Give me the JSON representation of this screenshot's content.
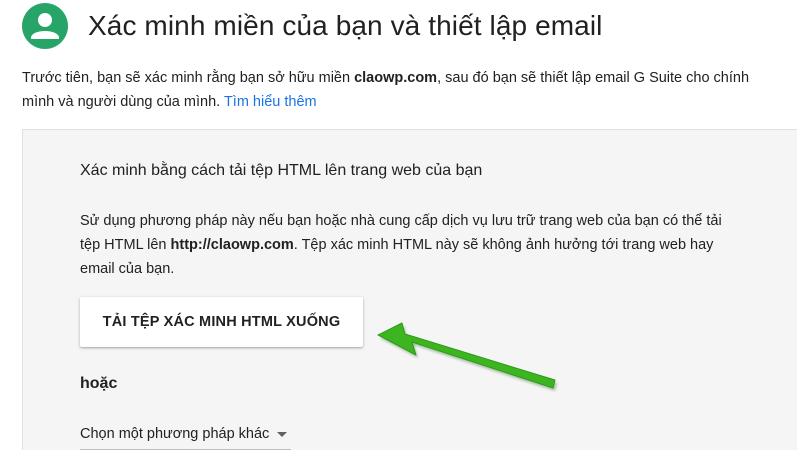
{
  "header": {
    "title": "Xác minh miền của bạn và thiết lập email"
  },
  "intro": {
    "text_before": "Trước tiên, bạn sẽ xác minh rằng bạn sở hữu miền ",
    "domain": "claowp.com",
    "text_after": ", sau đó bạn sẽ thiết lập email G Suite cho chính mình và người dùng của mình. ",
    "learn_more_link": "Tìm hiểu thêm"
  },
  "card": {
    "title": "Xác minh bằng cách tải tệp HTML lên trang web của bạn",
    "desc_before": "Sử dụng phương pháp này nếu bạn hoặc nhà cung cấp dịch vụ lưu trữ trang web của bạn có thể tải tệp HTML lên ",
    "desc_url": "http://claowp.com",
    "desc_after": ". Tệp xác minh HTML này sẽ không ảnh hưởng tới trang web hay email của bạn.",
    "download_button_label": "TẢI TỆP XÁC MINH HTML XUỐNG",
    "or_label": "hoặc",
    "method_select_label": "Chọn một phương pháp khác"
  },
  "colors": {
    "avatar": "#27a569",
    "link": "#1a73e8",
    "card_background": "#f5f5f5",
    "annotation_arrow": "#3cb521"
  },
  "icons": {
    "avatar": "account-circle-icon",
    "dropdown": "caret-down-icon",
    "annotation": "green-arrow-icon"
  }
}
